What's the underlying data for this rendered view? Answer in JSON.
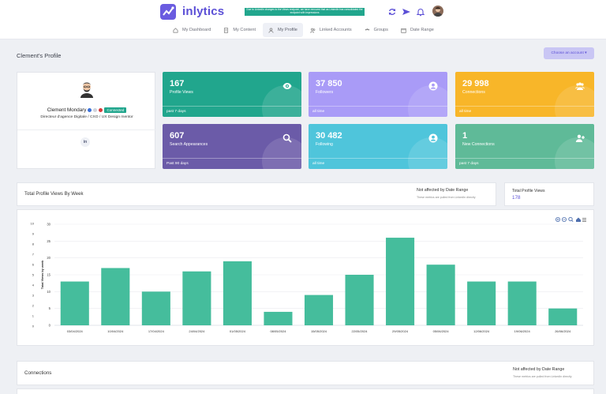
{
  "header": {
    "brand": "inlytics",
    "notice": "Due to LinkedIn changes to the Views endpoint, we have removed that as LinkedIn has consolidated the endpoint with Impressions",
    "nav": [
      {
        "label": "My Dashboard",
        "icon": "home-icon"
      },
      {
        "label": "My Content",
        "icon": "document-icon"
      },
      {
        "label": "My Profile",
        "icon": "user-icon"
      },
      {
        "label": "Linked Accounts",
        "icon": "users-icon"
      },
      {
        "label": "Groups",
        "icon": "group-icon"
      },
      {
        "label": "Date Range",
        "icon": "calendar-icon"
      }
    ]
  },
  "page": {
    "title": "Clement's Profile",
    "choose_account": "Choose an account ▾"
  },
  "profile": {
    "name": "Clement Mondary",
    "connected_badge": "Connected",
    "headline": "Directeur d'agence Digitale / CXO / UX Design mentor",
    "linkedin": "in"
  },
  "tiles": [
    {
      "value": "167",
      "label": "Profile Views",
      "period": "past 7 days",
      "color": "#21a68d",
      "icon": "eye-icon"
    },
    {
      "value": "37 850",
      "label": "Followers",
      "period": "all time",
      "color": "#a99bf7",
      "icon": "user-circle-icon"
    },
    {
      "value": "29 998",
      "label": "Connections",
      "period": "all time",
      "color": "#f8b629",
      "icon": "group-icon"
    },
    {
      "value": "607",
      "label": "Search Appearances",
      "period": "Past 90 days",
      "color": "#6b5ba8",
      "icon": "search-icon"
    },
    {
      "value": "30 482",
      "label": "Following",
      "period": "all time",
      "color": "#4fc5db",
      "icon": "user-circle-icon"
    },
    {
      "value": "1",
      "label": "New Connections",
      "period": "past 7 days",
      "color": "#5fba98",
      "icon": "user-plus-icon"
    }
  ],
  "chart_section": {
    "title": "Total Profile Views By Week",
    "note": "Not affected by Date Range",
    "note_sub": "These metrics are pulled from LinkedIn directly",
    "total_label": "Total Profile Views",
    "total_value": "178"
  },
  "chart_data": {
    "type": "bar",
    "categories": [
      "03/04/2024",
      "10/04/2024",
      "17/04/2024",
      "24/04/2024",
      "01/05/2024",
      "08/05/2024",
      "15/05/2024",
      "22/05/2024",
      "29/05/2024",
      "05/06/2024",
      "12/06/2024",
      "19/06/2024",
      "26/06/2024"
    ],
    "values": [
      13,
      17,
      10,
      16,
      19,
      4,
      9,
      15,
      26,
      18,
      13,
      13,
      5
    ],
    "ylabel": "Total Views by week",
    "ylim": [
      0,
      30
    ],
    "yticks": [
      0,
      5,
      10,
      15,
      20,
      25,
      30
    ],
    "yticks_left": [
      "0",
      "1",
      "2",
      "3",
      "4",
      "5",
      "6",
      "7",
      "8",
      "9",
      "10"
    ],
    "color": "#45bd9c",
    "grid": true
  },
  "connections": {
    "title": "Connections",
    "note": "Not affected by Date Range",
    "note_sub": "These metrics are pulled from LinkedIn directly"
  }
}
